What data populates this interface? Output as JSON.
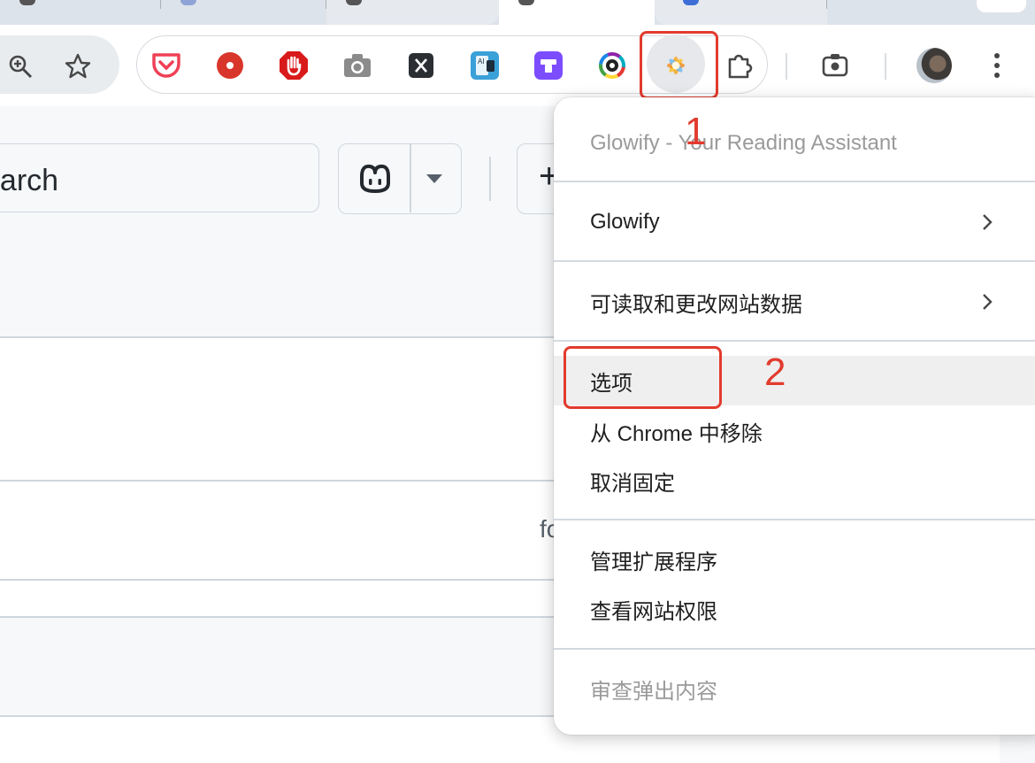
{
  "page_search": {
    "text": "earch"
  },
  "page_plus": {
    "text": "+"
  },
  "page_fragment": {
    "text": "fo"
  },
  "extensions": [
    {
      "name": "pocket",
      "color": "#ef4056"
    },
    {
      "name": "record",
      "color": "#d9362b"
    },
    {
      "name": "adblock",
      "color": "#d91a1a"
    },
    {
      "name": "camera",
      "color": "#8b8b8b"
    },
    {
      "name": "x-app",
      "color": "#2b2f33"
    },
    {
      "name": "ai-tool",
      "color": "#3aa0d8"
    },
    {
      "name": "purple-app",
      "color": "#7c4dff"
    },
    {
      "name": "color-ring",
      "color": "#222222"
    },
    {
      "name": "glowify",
      "color": "#f5a623"
    },
    {
      "name": "puzzle",
      "color": "#474747"
    }
  ],
  "menu": {
    "header": "Glowify - Your Reading Assistant",
    "items": [
      {
        "label": "Glowify",
        "submenu": true
      },
      {
        "label": "可读取和更改网站数据",
        "submenu": true
      },
      {
        "label": "选项"
      },
      {
        "label": "从 Chrome 中移除"
      },
      {
        "label": "取消固定"
      },
      {
        "label": "管理扩展程序"
      },
      {
        "label": "查看网站权限"
      },
      {
        "label": "审查弹出内容",
        "disabled": true
      }
    ]
  },
  "annotations": {
    "step1": "1",
    "step2": "2"
  },
  "colors": {
    "annotation": "#e23b2e",
    "menu_hover": "#efefef"
  }
}
